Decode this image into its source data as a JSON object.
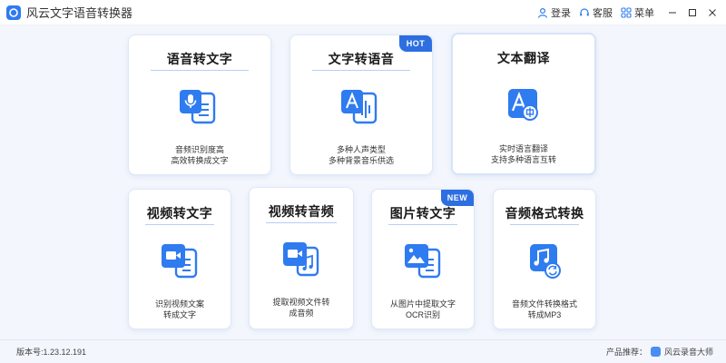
{
  "app": {
    "title": "风云文字语音转换器"
  },
  "toolbar": {
    "login": "登录",
    "service": "客服",
    "menu": "菜单"
  },
  "cards": [
    {
      "title": "语音转文字",
      "desc1": "音频识别度高",
      "desc2": "高效转换成文字",
      "icon": "mic-doc-icon"
    },
    {
      "title": "文字转语音",
      "desc1": "多种人声类型",
      "desc2": "多种背景音乐供选",
      "icon": "text-to-audio-icon",
      "badge": "HOT"
    },
    {
      "title": "文本翻译",
      "desc1": "实时语言翻译",
      "desc2": "支持多种语言互转",
      "icon": "translate-icon"
    },
    {
      "title": "视频转文字",
      "desc1": "识别视频文案",
      "desc2": "转成文字",
      "icon": "video-doc-icon"
    },
    {
      "title": "视频转音频",
      "desc1": "提取视频文件转",
      "desc2": "成音频",
      "icon": "video-music-icon"
    },
    {
      "title": "图片转文字",
      "desc1": "从图片中提取文字",
      "desc2": "OCR识别",
      "icon": "image-doc-icon",
      "badge": "NEW"
    },
    {
      "title": "音频格式转换",
      "desc1": "音频文件转换格式",
      "desc2": "转成MP3",
      "icon": "music-convert-icon"
    }
  ],
  "footer": {
    "version": "版本号:1.23.12.191",
    "promo_label": "产品推荐：",
    "promo_product": "风云录音大师"
  },
  "colors": {
    "accent": "#2f7bf0",
    "badge": "#2d6fe0",
    "background": "#f3f6fc"
  }
}
